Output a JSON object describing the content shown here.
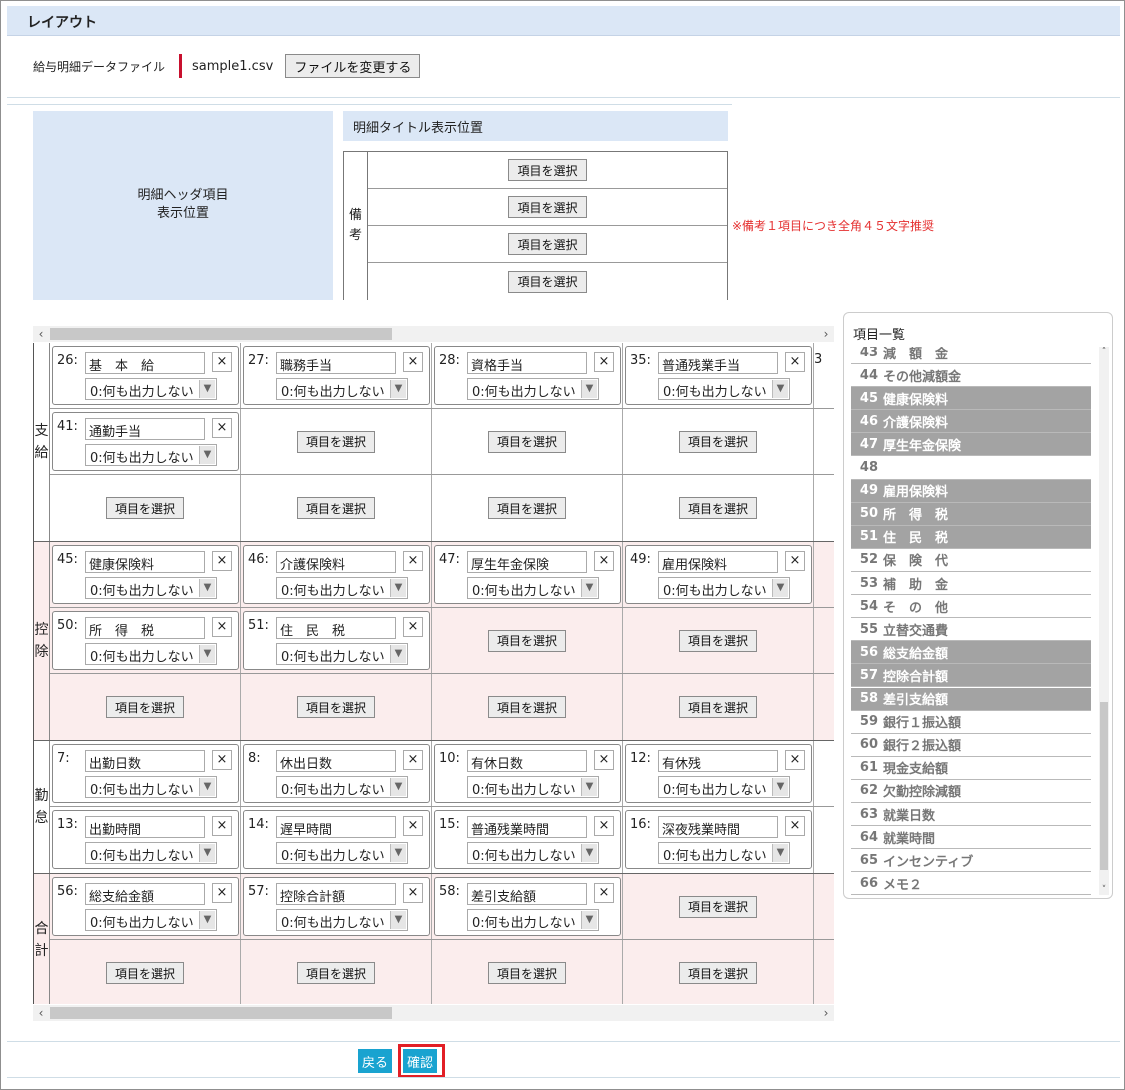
{
  "title": "レイアウト",
  "file": {
    "label": "給与明細データファイル",
    "name": "sample1.csv",
    "change_button": "ファイルを変更する"
  },
  "header_area": {
    "line1": "明細ヘッダ項目",
    "line2": "表示位置"
  },
  "title_position": "明細タイトル表示位置",
  "remarks": {
    "label_chars": [
      "備",
      "考"
    ],
    "buttons": [
      "項目を選択",
      "項目を選択",
      "項目を選択",
      "項目を選択"
    ]
  },
  "note": "※備考１項目につき全角４５文字推奨",
  "select_label": "項目を選択",
  "output_default": "0:何も出力しない",
  "groups": [
    {
      "label_chars": [
        "支",
        "給"
      ],
      "pink": false,
      "rows": [
        [
          {
            "num": "26:",
            "name": "基　本　給"
          },
          {
            "num": "27:",
            "name": "職務手当"
          },
          {
            "num": "28:",
            "name": "資格手当"
          },
          {
            "num": "35:",
            "name": "普通残業手当"
          },
          {
            "partial": "3"
          }
        ],
        [
          {
            "num": "41:",
            "name": "通勤手当"
          },
          {
            "select": true
          },
          {
            "select": true
          },
          {
            "select": true
          },
          {
            "partial": ""
          }
        ],
        [
          {
            "select": true
          },
          {
            "select": true
          },
          {
            "select": true
          },
          {
            "select": true
          },
          {
            "partial": ""
          }
        ]
      ]
    },
    {
      "label_chars": [
        "控",
        "除"
      ],
      "pink": true,
      "rows": [
        [
          {
            "num": "45:",
            "name": "健康保険料"
          },
          {
            "num": "46:",
            "name": "介護保険料"
          },
          {
            "num": "47:",
            "name": "厚生年金保険"
          },
          {
            "num": "49:",
            "name": "雇用保険料"
          },
          {
            "partial": ""
          }
        ],
        [
          {
            "num": "50:",
            "name": "所　得　税"
          },
          {
            "num": "51:",
            "name": "住　民　税"
          },
          {
            "select": true
          },
          {
            "select": true
          },
          {
            "partial": ""
          }
        ],
        [
          {
            "select": true
          },
          {
            "select": true
          },
          {
            "select": true
          },
          {
            "select": true
          },
          {
            "partial": ""
          }
        ]
      ]
    },
    {
      "label_chars": [
        "勤",
        "怠"
      ],
      "pink": false,
      "rows": [
        [
          {
            "num": "7:",
            "name": "出勤日数"
          },
          {
            "num": "8:",
            "name": "休出日数"
          },
          {
            "num": "10:",
            "name": "有休日数"
          },
          {
            "num": "12:",
            "name": "有休残"
          },
          {
            "partial": ""
          }
        ],
        [
          {
            "num": "13:",
            "name": "出勤時間"
          },
          {
            "num": "14:",
            "name": "遅早時間"
          },
          {
            "num": "15:",
            "name": "普通残業時間"
          },
          {
            "num": "16:",
            "name": "深夜残業時間"
          },
          {
            "partial": ""
          }
        ]
      ]
    },
    {
      "label_chars": [
        "合",
        "計"
      ],
      "pink": true,
      "rows": [
        [
          {
            "num": "56:",
            "name": "総支給金額"
          },
          {
            "num": "57:",
            "name": "控除合計額"
          },
          {
            "num": "58:",
            "name": "差引支給額"
          },
          {
            "select": true
          },
          {
            "partial": ""
          }
        ],
        [
          {
            "select": true
          },
          {
            "select": true
          },
          {
            "select": true
          },
          {
            "select": true
          },
          {
            "partial": ""
          }
        ]
      ]
    }
  ],
  "item_list": {
    "title": "項目一覧",
    "items": [
      {
        "num": "43",
        "name": "減　額　金",
        "selected": false
      },
      {
        "num": "44",
        "name": "その他減額金",
        "selected": false
      },
      {
        "num": "45",
        "name": "健康保険料",
        "selected": true
      },
      {
        "num": "46",
        "name": "介護保険料",
        "selected": true
      },
      {
        "num": "47",
        "name": "厚生年金保険",
        "selected": true
      },
      {
        "num": "48",
        "name": "",
        "selected": false
      },
      {
        "num": "49",
        "name": "雇用保険料",
        "selected": true
      },
      {
        "num": "50",
        "name": "所　得　税",
        "selected": true
      },
      {
        "num": "51",
        "name": "住　民　税",
        "selected": true
      },
      {
        "num": "52",
        "name": "保　険　代",
        "selected": false
      },
      {
        "num": "53",
        "name": "補　助　金",
        "selected": false
      },
      {
        "num": "54",
        "name": "そ　の　他",
        "selected": false
      },
      {
        "num": "55",
        "name": "立替交通費",
        "selected": false
      },
      {
        "num": "56",
        "name": "総支給金額",
        "selected": true
      },
      {
        "num": "57",
        "name": "控除合計額",
        "selected": true
      },
      {
        "num": "58",
        "name": "差引支給額",
        "selected": true
      },
      {
        "num": "59",
        "name": "銀行１振込額",
        "selected": false
      },
      {
        "num": "60",
        "name": "銀行２振込額",
        "selected": false
      },
      {
        "num": "61",
        "name": "現金支給額",
        "selected": false
      },
      {
        "num": "62",
        "name": "欠勤控除減額",
        "selected": false
      },
      {
        "num": "63",
        "name": "就業日数",
        "selected": false
      },
      {
        "num": "64",
        "name": "就業時間",
        "selected": false
      },
      {
        "num": "65",
        "name": "インセンティブ",
        "selected": false
      },
      {
        "num": "66",
        "name": "メモ２",
        "selected": false
      }
    ]
  },
  "footer": {
    "back": "戻る",
    "confirm": "確認"
  }
}
